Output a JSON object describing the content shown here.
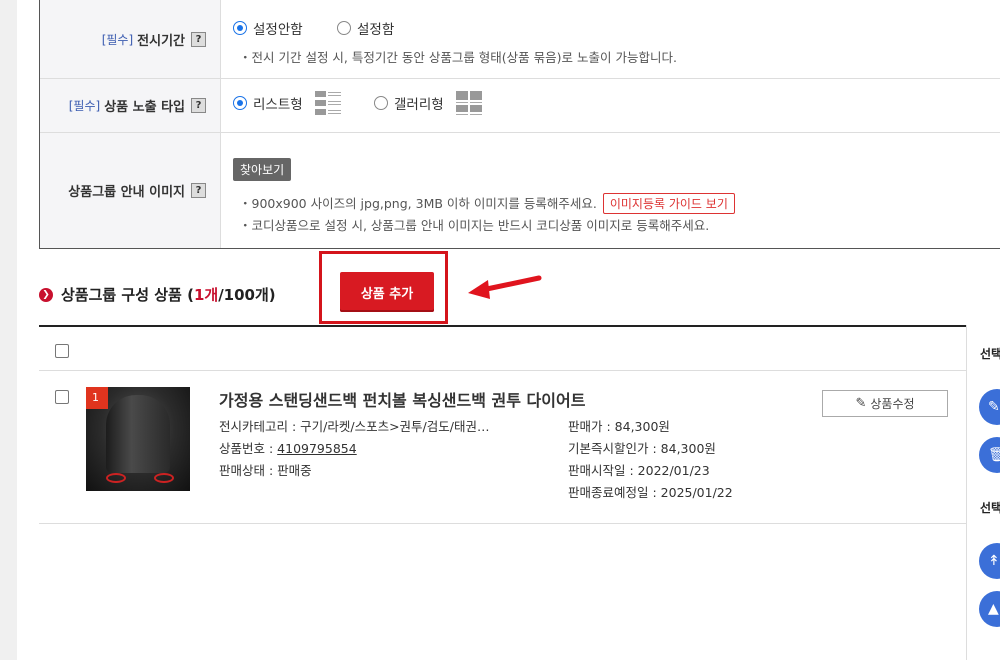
{
  "form": {
    "display_period": {
      "required": "[필수]",
      "label": "전시기간",
      "help": "?",
      "options": [
        "설정안함",
        "설정함"
      ],
      "selected": "설정안함",
      "note": "・전시 기간 설정 시, 특정기간 동안 상품그룹 형태(상품 묶음)로 노출이 가능합니다."
    },
    "exposure_type": {
      "required": "[필수]",
      "label": "상품 노출 타입",
      "help": "?",
      "options": [
        "리스트형",
        "갤러리형"
      ],
      "selected": "리스트형",
      "option_icons": [
        "list-layout-icon",
        "gallery-layout-icon"
      ]
    },
    "guide_image": {
      "label": "상품그룹 안내 이미지",
      "help": "?",
      "browse_label": "찾아보기",
      "note1": "・900x900 사이즈의 jpg,png, 3MB 이하 이미지를 등록해주세요.",
      "guide_button": "이미지등록 가이드 보기",
      "note2": "・코디상품으로 설정 시, 상품그룹 안내 이미지는 반드시 코디상품 이미지로 등록해주세요."
    }
  },
  "section": {
    "title_prefix": "상품그룹 구성 상품 (",
    "count": "1개",
    "title_suffix": " /100개)",
    "add_button": "상품 추가",
    "accent_color": "#d81a22"
  },
  "product": {
    "badge": "1",
    "title": "가정용 스탠딩샌드백 펀치볼 복싱샌드백 권투 다이어트",
    "category": "전시카테고리 : 구기/라켓/스포츠>권투/검도/태권…",
    "number_label": "상품번호 : ",
    "number": "4109795854",
    "status": "판매상태 : 판매중",
    "price": "판매가 : 84,300원",
    "discount_price": "기본즉시할인가 : 84,300원",
    "start_date": "판매시작일 : 2022/01/23",
    "end_date": "판매종료예정일 : 2025/01/22",
    "edit_button": "상품수정"
  },
  "side_panel": {
    "label1": "선택",
    "label2": "선택",
    "buttons": [
      "edit-icon",
      "delete-icon",
      "move-top-icon",
      "move-up-icon"
    ]
  }
}
